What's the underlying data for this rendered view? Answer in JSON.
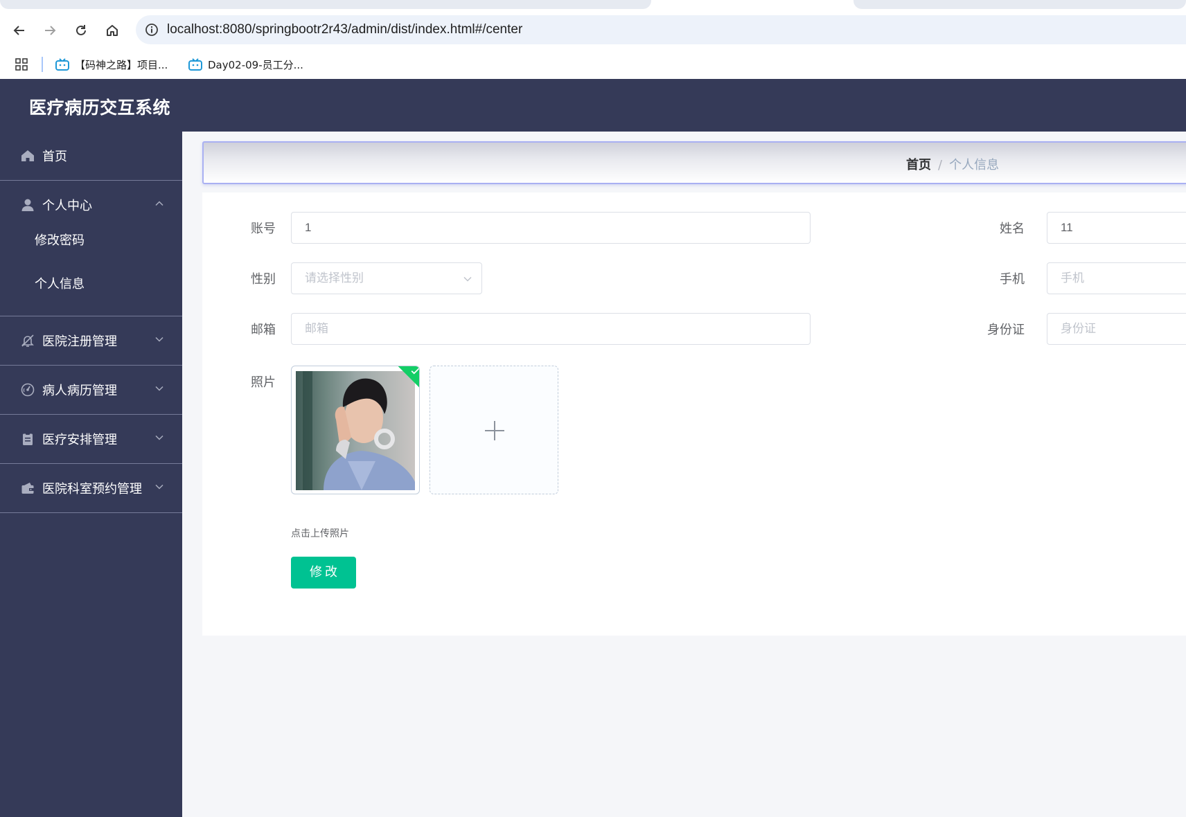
{
  "browser": {
    "url": "localhost:8080/springbootr2r43/admin/dist/index.html#/center",
    "bookmarks": [
      {
        "label": "【码神之路】项目...",
        "icon": "bilibili-icon"
      },
      {
        "label": "Day02-09-员工分...",
        "icon": "bilibili-icon"
      }
    ]
  },
  "app": {
    "title": "医疗病历交互系统"
  },
  "sidebar": {
    "items": [
      {
        "label": "首页",
        "icon": "home-icon"
      },
      {
        "label": "个人中心",
        "icon": "user-icon",
        "expanded": true,
        "children": [
          {
            "label": "修改密码"
          },
          {
            "label": "个人信息"
          }
        ]
      },
      {
        "label": "医院注册管理",
        "icon": "bell-off-icon"
      },
      {
        "label": "病人病历管理",
        "icon": "gauge-icon"
      },
      {
        "label": "医疗安排管理",
        "icon": "clipboard-icon"
      },
      {
        "label": "医院科室预约管理",
        "icon": "wallet-icon"
      }
    ]
  },
  "breadcrumb": {
    "home": "首页",
    "separator": "/",
    "current": "个人信息"
  },
  "form": {
    "account_label": "账号",
    "account_value": "1",
    "name_label": "姓名",
    "name_value": "11",
    "gender_label": "性别",
    "gender_placeholder": "请选择性别",
    "phone_label": "手机",
    "phone_placeholder": "手机",
    "email_label": "邮箱",
    "email_placeholder": "邮箱",
    "idcard_label": "身份证",
    "idcard_placeholder": "身份证",
    "photo_label": "照片",
    "upload_tip": "点击上传照片",
    "submit_label": "修改"
  },
  "colors": {
    "sidebar_bg": "#353a58",
    "primary_button": "#00c292",
    "success_badge": "#13ce66"
  }
}
